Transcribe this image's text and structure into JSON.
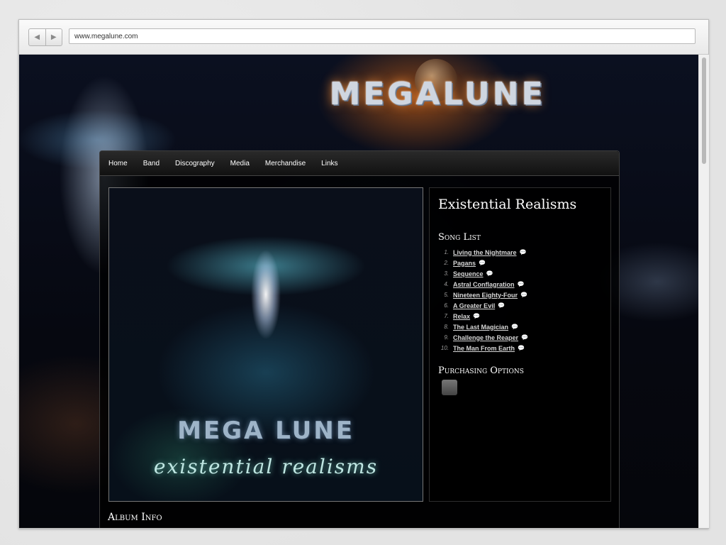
{
  "browser": {
    "url": "www.megalune.com",
    "back_glyph": "◀",
    "forward_glyph": "▶"
  },
  "site": {
    "logo_text": "MEGALUNE",
    "nav": [
      "Home",
      "Band",
      "Discography",
      "Media",
      "Merchandise",
      "Links"
    ]
  },
  "album": {
    "title": "Existential Realisms",
    "cover_band": "MEGA LUNE",
    "cover_title": "existential realisms",
    "song_list_heading": "Song List",
    "songs": [
      {
        "num": "1.",
        "title": "Living the Nightmare"
      },
      {
        "num": "2.",
        "title": "Pagans"
      },
      {
        "num": "3.",
        "title": "Sequence"
      },
      {
        "num": "4.",
        "title": "Astral Conflagration"
      },
      {
        "num": "5.",
        "title": "Nineteen Eighty-Four"
      },
      {
        "num": "6.",
        "title": "A Greater Evil"
      },
      {
        "num": "7.",
        "title": "Relax"
      },
      {
        "num": "8.",
        "title": "The Last Magician"
      },
      {
        "num": "9.",
        "title": "Challenge the Reaper"
      },
      {
        "num": "10.",
        "title": "The Man From Earth"
      }
    ],
    "comment_glyph": "💬",
    "purchasing_heading": "Purchasing Options",
    "purchase_icon_glyph": "",
    "album_info_heading": "Album Info"
  },
  "colors": {
    "page_bg": "#e6e6e6",
    "site_bg": "#05070d",
    "accent_orange": "#ff7a1a"
  }
}
